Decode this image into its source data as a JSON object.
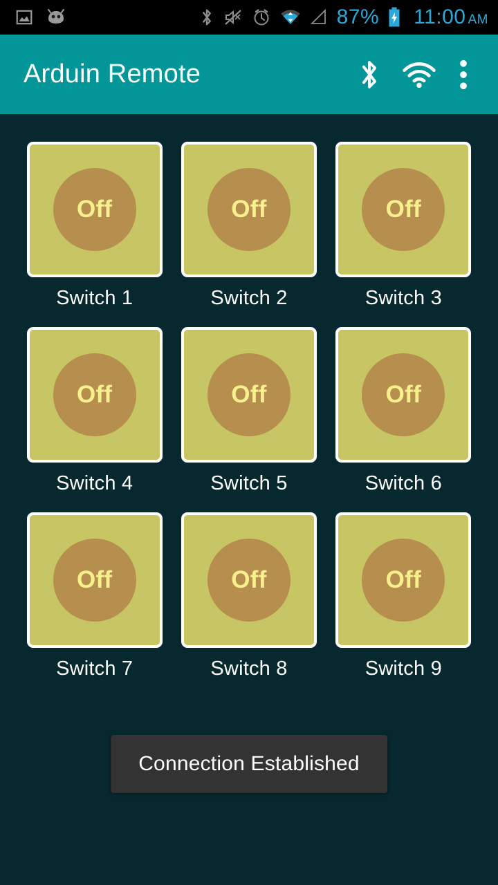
{
  "status_bar": {
    "background": "#000000",
    "accent": "#2aa8d8",
    "left_icons": [
      {
        "name": "photo-icon",
        "label": "Screenshot"
      },
      {
        "name": "android-head-icon",
        "label": "Android"
      }
    ],
    "right_icons": [
      {
        "name": "bluetooth-icon",
        "label": "Bluetooth"
      },
      {
        "name": "volume-mute-icon",
        "label": "Silent"
      },
      {
        "name": "alarm-clock-icon",
        "label": "Alarm"
      },
      {
        "name": "wifi-icon",
        "label": "Wi-Fi"
      },
      {
        "name": "cell-signal-icon",
        "label": "No signal"
      }
    ],
    "battery_percent": "87%",
    "battery_icon": "battery-charging-icon",
    "time": "11:00",
    "time_period": "AM"
  },
  "app_bar": {
    "title": "Arduin Remote",
    "background": "#029699",
    "text_color": "#ffffff",
    "actions": [
      {
        "name": "bluetooth-action-icon",
        "label": "Bluetooth"
      },
      {
        "name": "wifi-action-icon",
        "label": "Wi-Fi"
      },
      {
        "name": "overflow-menu-icon",
        "label": "More options"
      }
    ]
  },
  "main": {
    "background": "#07282e",
    "tile_color": "#c8c564",
    "knob_color": "#b68e4e",
    "state_text_color": "#f8ef8e",
    "border_color": "#ffffff",
    "switches": [
      {
        "label": "Switch 1",
        "state": "Off"
      },
      {
        "label": "Switch 2",
        "state": "Off"
      },
      {
        "label": "Switch 3",
        "state": "Off"
      },
      {
        "label": "Switch 4",
        "state": "Off"
      },
      {
        "label": "Switch 5",
        "state": "Off"
      },
      {
        "label": "Switch 6",
        "state": "Off"
      },
      {
        "label": "Switch 7",
        "state": "Off"
      },
      {
        "label": "Switch 8",
        "state": "Off"
      },
      {
        "label": "Switch 9",
        "state": "Off"
      }
    ]
  },
  "toast": {
    "message": "Connection Established",
    "background": "#333333",
    "text_color": "#ffffff"
  }
}
